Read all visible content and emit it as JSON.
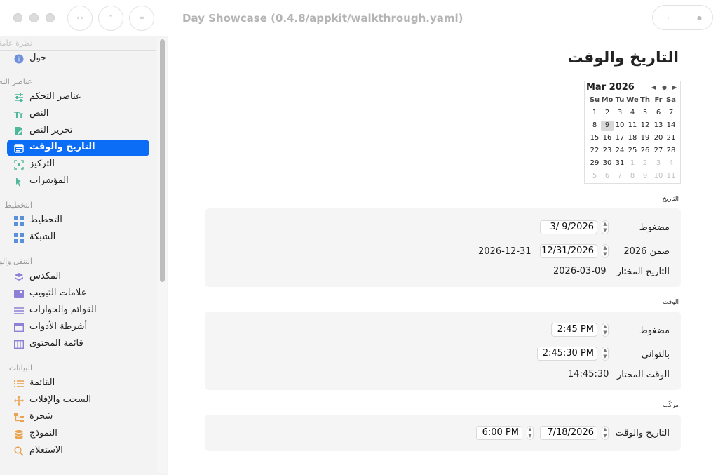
{
  "window": {
    "title": "Day Showcase (0.4.8/appkit/walkthrough.yaml)",
    "toolbar_left": [
      "‹ ›",
      "⌃",
      "="
    ],
    "toolbar_right": [
      "‹",
      "●"
    ]
  },
  "sidebar": {
    "sections": [
      {
        "title": "نظرة عامة",
        "items": [
          {
            "label": "حول",
            "icon": "info-icon"
          }
        ]
      },
      {
        "title": "عناصر التحكم",
        "items": [
          {
            "label": "عناصر التحكم",
            "icon": "sliders-icon"
          },
          {
            "label": "النص",
            "icon": "text-icon"
          },
          {
            "label": "تحرير النص",
            "icon": "edit-document-icon"
          },
          {
            "label": "التاريخ والوقت",
            "icon": "calendar-icon",
            "selected": true
          },
          {
            "label": "التركيز",
            "icon": "focus-icon"
          },
          {
            "label": "المؤشرات",
            "icon": "cursor-icon"
          }
        ]
      },
      {
        "title": "التخطيط",
        "items": [
          {
            "label": "التخطيط",
            "icon": "layout-grid-icon"
          },
          {
            "label": "الشبكة",
            "icon": "grid-icon"
          }
        ]
      },
      {
        "title": "التنقل والواجهة",
        "items": [
          {
            "label": "المكدس",
            "icon": "stack-icon"
          },
          {
            "label": "علامات التبويب",
            "icon": "tabs-icon"
          },
          {
            "label": "القوائم والحوارات",
            "icon": "menu-icon"
          },
          {
            "label": "أشرطة الأدوات",
            "icon": "toolbar-icon"
          },
          {
            "label": "قائمة المحتوى",
            "icon": "columns-icon"
          }
        ]
      },
      {
        "title": "البيانات",
        "items": [
          {
            "label": "القائمة",
            "icon": "list-icon"
          },
          {
            "label": "السحب والإفلات",
            "icon": "move-icon"
          },
          {
            "label": "شجرة",
            "icon": "tree-icon"
          },
          {
            "label": "النموذج",
            "icon": "database-icon"
          },
          {
            "label": "الاستعلام",
            "icon": "search-icon"
          }
        ]
      }
    ]
  },
  "main": {
    "title": "التاريخ والوقت",
    "calendar": {
      "month_label": "Mar 2026",
      "nav": [
        "◀",
        "●",
        "▶"
      ],
      "weekdays": [
        "Su",
        "Mo",
        "Tu",
        "We",
        "Th",
        "Fr",
        "Sa"
      ],
      "weeks": [
        [
          "1",
          "2",
          "3",
          "4",
          "5",
          "6",
          "7"
        ],
        [
          "8",
          "9",
          "10",
          "11",
          "12",
          "13",
          "14"
        ],
        [
          "15",
          "16",
          "17",
          "18",
          "19",
          "20",
          "21"
        ],
        [
          "22",
          "23",
          "24",
          "25",
          "26",
          "27",
          "28"
        ],
        [
          "29",
          "30",
          "31",
          "1",
          "2",
          "3",
          "4"
        ],
        [
          "5",
          "6",
          "7",
          "8",
          "9",
          "10",
          "11"
        ]
      ],
      "selected_day": "9"
    },
    "date_group": {
      "label": "التاريخ",
      "compact_label": "مضغوط",
      "compact_value": "3/  9/2026",
      "range_label": "ضمن 2026",
      "range_value": "12/31/2026",
      "range_readout": "2026-12-31",
      "selected_label": "التاريخ المختار",
      "selected_value": "2026-03-09"
    },
    "time_group": {
      "label": "الوقت",
      "compact_label": "مضغوط",
      "compact_value": "2:45 PM",
      "seconds_label": "بالثواني",
      "seconds_value": "2:45:30 PM",
      "selected_label": "الوقت المختار",
      "selected_value": "14:45:30"
    },
    "combined_group": {
      "label": "مركّب",
      "row_label": "التاريخ والوقت",
      "date_value": "7/18/2026",
      "time_value": "6:00 PM"
    }
  },
  "colors": {
    "accent": "#0b6cf5",
    "sidebar_bg": "#f3f3f3",
    "group_bg": "#f5f5f5"
  }
}
